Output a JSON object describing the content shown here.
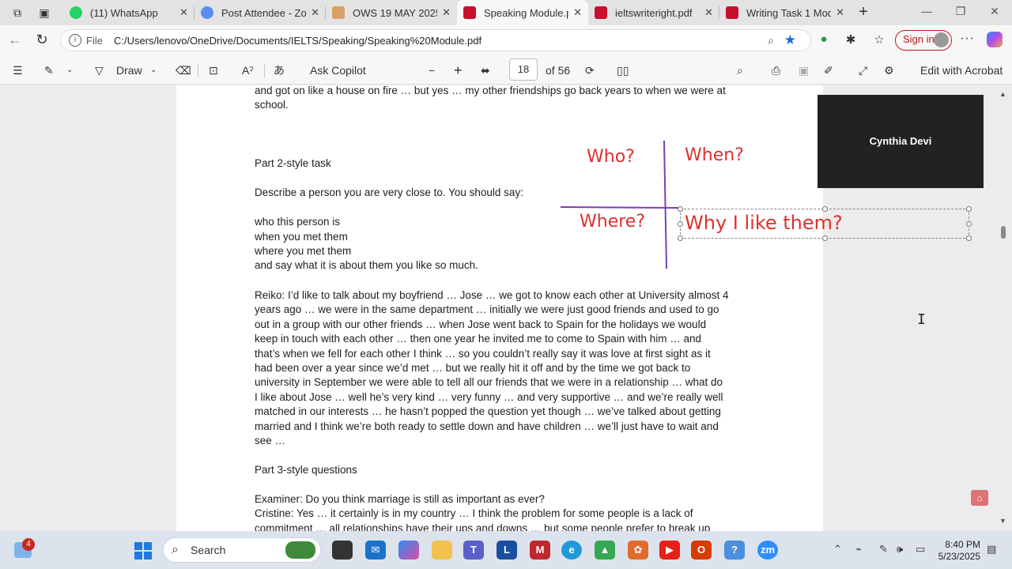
{
  "tabs": [
    {
      "label": "(11) WhatsApp",
      "favicon_color": "#25d366"
    },
    {
      "label": "Post Attendee - Zoom",
      "favicon_color": "#5b8def"
    },
    {
      "label": "OWS 19 MAY 2025",
      "favicon_color": "#d9a066"
    },
    {
      "label": "Speaking Module.pdf",
      "favicon_color": "#c8102e",
      "active": true
    },
    {
      "label": "ieltswriteright.pdf",
      "favicon_color": "#c8102e"
    },
    {
      "label": "Writing Task 1 Module",
      "favicon_color": "#c8102e"
    }
  ],
  "address": {
    "scheme": "File",
    "url": "C:/Users/lenovo/OneDrive/Documents/IELTS/Speaking/Speaking%20Module.pdf"
  },
  "profile": {
    "signin_label": "Sign in"
  },
  "pdf_toolbar": {
    "draw_label": "Draw",
    "ask_copilot_label": "Ask Copilot",
    "current_page": "18",
    "page_count": "of 56",
    "edit_label": "Edit with Acrobat"
  },
  "document": {
    "top_lines": [
      "and got on like a house on fire … but yes … my other friendships go back years to when we were at",
      " school."
    ],
    "part2_heading": "Part 2-style task",
    "task_prompt": "Describe a person you are very close to. You should say:",
    "bullets": [
      "who this person is",
      "when you met them",
      "where you met them",
      "and say what it is about them you like so much."
    ],
    "answer_lines": [
      "Reiko: I’d like to talk about my boyfriend … Jose … we got to know each other at University almost 4",
      "years ago … we were in the same department … initially we were just good friends and used to go",
      "out in a group with our other friends … when Jose went back to Spain for the holidays we would",
      "keep in touch with each other … then one year he invited me to come to Spain with him …  and",
      "that’s when we fell for each other I think … so you couldn’t really say it was love at first sight as it",
      "had been over a year since we’d met … but we really hit it off and by the time we got back to",
      "university in September we were able to tell all our friends that we were in a relationship … what do",
      "I like about Jose … well he’s very kind … very funny … and very supportive … and we’re really well",
      "matched in our interests … he hasn’t popped the question yet though … we’ve talked about getting",
      "married and I think we’re both ready to settle down and have children  … we’ll just have to wait and",
      "see …"
    ],
    "part3_heading": "Part 3-style questions",
    "examiner_line": "Examiner: Do you think marriage is still as important as ever?",
    "cristine_lines": [
      "Cristine: Yes … it certainly is in my country … I think the problem for some people is a lack of",
      "commitment … all relationships have their ups and downs … but some people prefer to break up"
    ]
  },
  "annotations": {
    "who": "Who?",
    "when": "When?",
    "where": "Where?",
    "why": "Why I like them?",
    "color": "#e0302d"
  },
  "video_tile": {
    "name": "Cynthia Devi"
  },
  "taskbar": {
    "search_label": "Search",
    "weather_badge": "4",
    "time": "8:40 PM",
    "date": "5/23/2025"
  }
}
